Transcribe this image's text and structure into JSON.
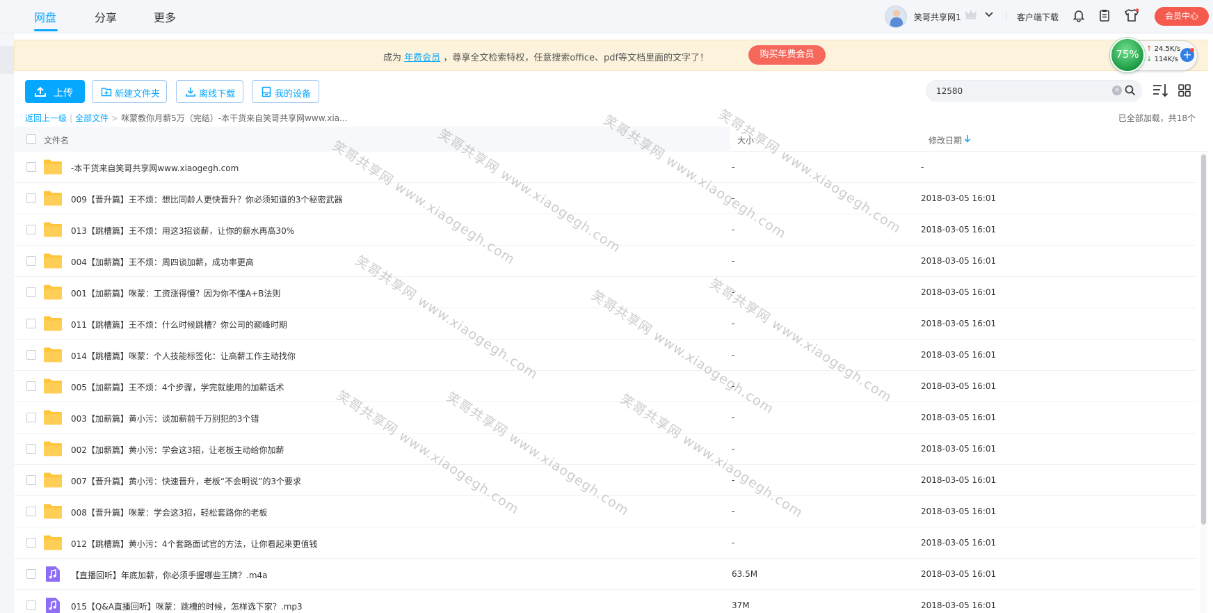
{
  "nav": {
    "tabs": [
      {
        "label": "网盘",
        "active": true
      },
      {
        "label": "分享",
        "active": false
      },
      {
        "label": "更多",
        "active": false
      }
    ]
  },
  "user": {
    "name": "笑哥共享网1",
    "client_download": "客户端下载",
    "member_center": "会员中心"
  },
  "banner": {
    "prefix": "成为",
    "link": "年费会员",
    "suffix": "，尊享全文检索特权，任意搜索office、pdf等文档里面的文字了！",
    "buy_button": "购买年费会员"
  },
  "speed": {
    "percent": "75%",
    "upload": "24.5K/s",
    "download": "114K/s"
  },
  "toolbar": {
    "upload": "上传",
    "new_folder": "新建文件夹",
    "offline_download": "离线下载",
    "my_device": "我的设备",
    "search_value": "12580"
  },
  "breadcrumb": {
    "back": "返回上一级",
    "all_files": "全部文件",
    "separator": "|",
    "arrow": ">",
    "current": "咪蒙教你月薪5万（完结）-本干货来自笑哥共享网www.xia..."
  },
  "load_status": "已全部加载，共18个",
  "columns": {
    "name": "文件名",
    "size": "大小",
    "date": "修改日期"
  },
  "files": [
    {
      "name": "-本干货来自笑哥共享网www.xiaogegh.com",
      "size": "-",
      "date": "-",
      "type": "folder"
    },
    {
      "name": "009【晋升篇】王不烦：想比同龄人更快晋升？你必须知道的3个秘密武器",
      "size": "-",
      "date": "2018-03-05 16:01",
      "type": "folder"
    },
    {
      "name": "013【跳槽篇】王不烦：用这3招谈薪，让你的薪水再高30%",
      "size": "-",
      "date": "2018-03-05 16:01",
      "type": "folder"
    },
    {
      "name": "004【加薪篇】王不烦：周四谈加薪，成功率更高",
      "size": "-",
      "date": "2018-03-05 16:01",
      "type": "folder"
    },
    {
      "name": "001【加薪篇】咪蒙：工资涨得慢？因为你不懂A+B法则",
      "size": "-",
      "date": "2018-03-05 16:01",
      "type": "folder"
    },
    {
      "name": "011【跳槽篇】王不烦：什么时候跳槽？你公司的巅峰时期",
      "size": "-",
      "date": "2018-03-05 16:01",
      "type": "folder"
    },
    {
      "name": "014【跳槽篇】咪蒙：个人技能标签化：让高薪工作主动找你",
      "size": "-",
      "date": "2018-03-05 16:01",
      "type": "folder"
    },
    {
      "name": "005【加薪篇】王不烦：4个步骤，学完就能用的加薪话术",
      "size": "-",
      "date": "2018-03-05 16:01",
      "type": "folder"
    },
    {
      "name": "003【加薪篇】黄小污：谈加薪前千万别犯的3个错",
      "size": "-",
      "date": "2018-03-05 16:01",
      "type": "folder"
    },
    {
      "name": "002【加薪篇】黄小污：学会这3招，让老板主动给你加薪",
      "size": "-",
      "date": "2018-03-05 16:01",
      "type": "folder"
    },
    {
      "name": "007【晋升篇】黄小污：快速晋升，老板“不会明说”的3个要求",
      "size": "-",
      "date": "2018-03-05 16:01",
      "type": "folder"
    },
    {
      "name": "008【晋升篇】咪蒙：学会这3招，轻松套路你的老板",
      "size": "-",
      "date": "2018-03-05 16:01",
      "type": "folder"
    },
    {
      "name": "012【跳槽篇】黄小污：4个套路面试官的方法，让你看起来更值钱",
      "size": "-",
      "date": "2018-03-05 16:01",
      "type": "folder"
    },
    {
      "name": "【直播回听】年底加薪，你必须手握哪些王牌？.m4a",
      "size": "63.5M",
      "date": "2018-03-05 16:01",
      "type": "audio"
    },
    {
      "name": "015【Q&A直播回听】咪蒙：跳槽的时候，怎样选下家？.mp3",
      "size": "37M",
      "date": "2018-03-05 16:01",
      "type": "audio"
    }
  ],
  "watermark": "笑哥共享网 www.xiaogegh.com",
  "colors": {
    "accent": "#06a7ff",
    "folder": "#ffc53d",
    "audio": "#8e6df5",
    "danger": "#f55a4e"
  }
}
